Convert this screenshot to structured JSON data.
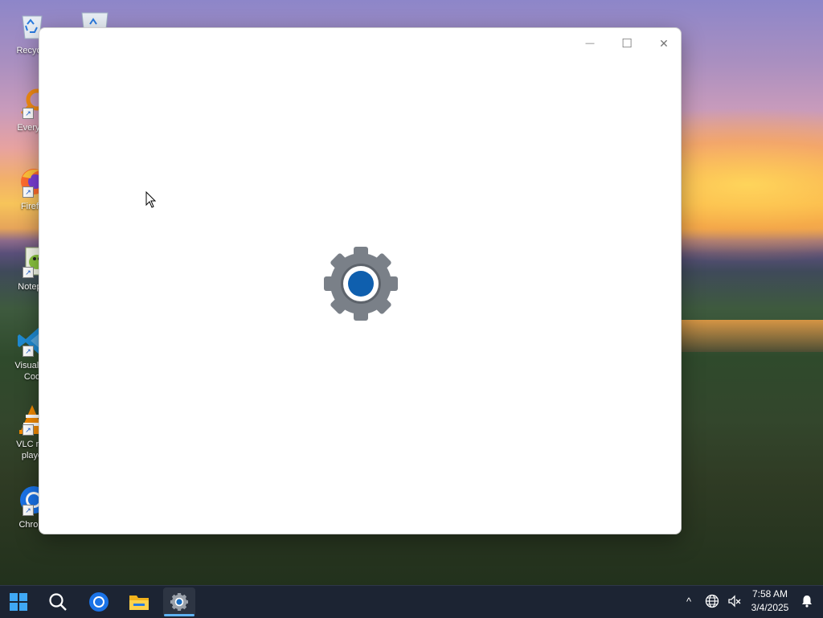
{
  "desktop": {
    "icons": [
      {
        "label": "Recycle",
        "icon": "recycle-bin-icon"
      },
      {
        "label": "Everyth",
        "icon": "everything-search-icon"
      },
      {
        "label": "Firefo",
        "icon": "firefox-icon"
      },
      {
        "label": "Notepa",
        "icon": "notepad-plus-plus-icon"
      },
      {
        "label_line1": "Visual St",
        "label_line2": "Cod",
        "icon": "vscode-icon"
      },
      {
        "label_line1": "VLC me",
        "label_line2": "playe",
        "icon": "vlc-icon"
      },
      {
        "label": "Chrom",
        "icon": "chrome-icon"
      }
    ]
  },
  "window": {
    "controls": {
      "minimize": "—",
      "maximize": "☐",
      "close": "✕"
    },
    "splash_icon": "settings-gear-icon"
  },
  "taskbar": {
    "items": [
      {
        "name": "start",
        "icon": "windows-start-icon"
      },
      {
        "name": "search",
        "icon": "search-icon"
      },
      {
        "name": "chrome",
        "icon": "chrome-icon"
      },
      {
        "name": "file-explorer",
        "icon": "folder-icon"
      },
      {
        "name": "settings",
        "icon": "settings-gear-icon",
        "active": true
      }
    ],
    "tray": {
      "chevron": "^",
      "network_icon": "globe-network-icon",
      "volume_icon": "no-audio-icon",
      "time": "7:58 AM",
      "date": "3/4/2025",
      "notification_icon": "bell-icon"
    }
  },
  "colors": {
    "taskbar_bg": "#1c2433",
    "accent": "#5fb2f2",
    "gear_gray": "#7a8088",
    "gear_blue": "#0f5fae"
  }
}
